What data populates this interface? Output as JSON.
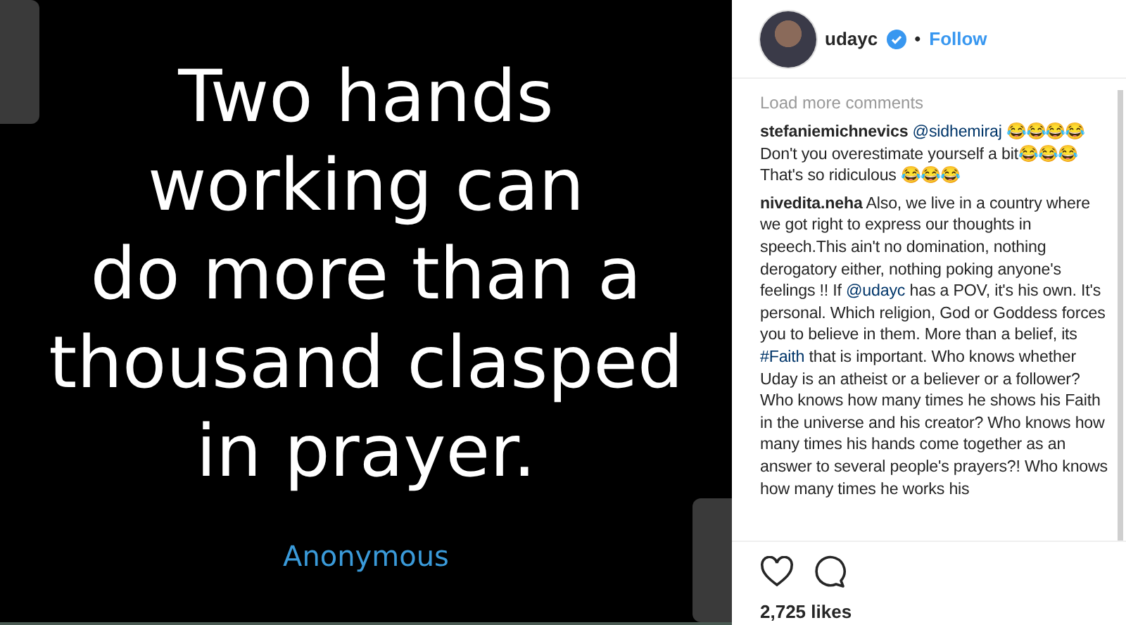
{
  "post_image": {
    "quote": "Two hands\nworking can\ndo more than a\nthousand clasped\nin prayer.",
    "author": "Anonymous"
  },
  "header": {
    "username": "udayc",
    "verified": true,
    "separator": "•",
    "follow": "Follow"
  },
  "load_more": "Load more comments",
  "comments": [
    {
      "username": "stefaniemichnevics",
      "parts": [
        {
          "kind": "mention",
          "text": "@sidhemiraj"
        },
        {
          "kind": "text",
          "text": " 😂😂😂😂\nDon't you overestimate yourself a bit😂😂😂\nThat's so ridiculous 😂😂😂"
        }
      ]
    },
    {
      "username": "nivedita.neha",
      "parts": [
        {
          "kind": "text",
          "text": " Also, we live in a country where we got right to express our thoughts in speech.This ain't no domination, nothing derogatory either, nothing poking anyone's feelings !! If "
        },
        {
          "kind": "mention",
          "text": "@udayc"
        },
        {
          "kind": "text",
          "text": " has a POV, it's his own. It's personal. Which religion, God or Goddess forces you to believe in them. More than a belief, its "
        },
        {
          "kind": "hashtag",
          "text": "#Faith"
        },
        {
          "kind": "text",
          "text": " that is important. Who knows whether Uday is an atheist or a believer or a follower? Who knows how many times he shows his Faith in the universe and his creator? Who knows how many times his hands come together as an answer to several people's prayers?! Who knows how many times he works his"
        }
      ]
    }
  ],
  "likes": "2,725 likes"
}
